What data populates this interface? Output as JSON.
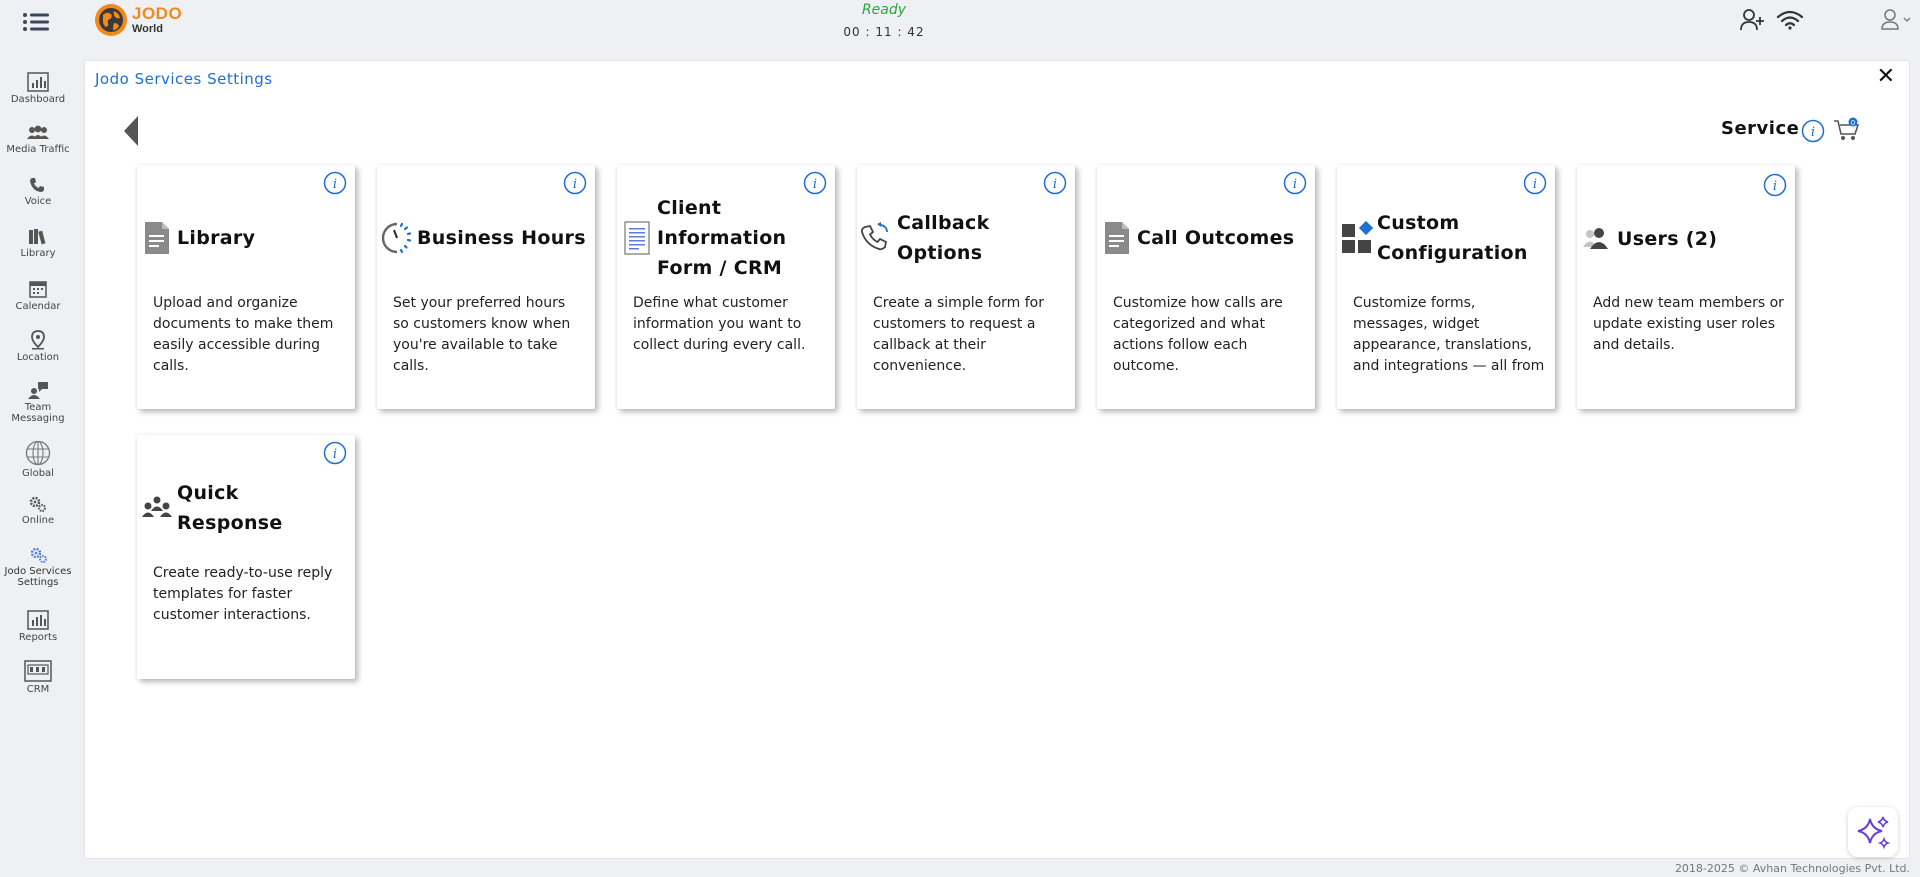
{
  "header": {
    "brand": "JODO",
    "brand_sub": "World",
    "status": "Ready",
    "timer": "00 : 11 : 42"
  },
  "colors": {
    "accent": "#1f6fd1",
    "ready": "#2aa93d",
    "brand": "#f08a1c"
  },
  "sidebar": {
    "items": [
      {
        "label": "Dashboard",
        "icon": "dashboard-icon"
      },
      {
        "label": "Media Traffic",
        "icon": "media-traffic-icon"
      },
      {
        "label": "Voice",
        "icon": "phone-icon"
      },
      {
        "label": "Library",
        "icon": "library-icon"
      },
      {
        "label": "Calendar",
        "icon": "calendar-icon"
      },
      {
        "label": "Location",
        "icon": "location-pin-icon"
      },
      {
        "label": "Team Messaging",
        "icon": "team-messaging-icon"
      },
      {
        "label": "Global",
        "icon": "globe-icon"
      },
      {
        "label": "Online",
        "icon": "gears-icon"
      },
      {
        "label": "Jodo Services Settings",
        "icon": "settings-gears-icon"
      },
      {
        "label": "Reports",
        "icon": "reports-icon"
      },
      {
        "label": "CRM",
        "icon": "crm-icon"
      }
    ]
  },
  "panel": {
    "title": "Jodo Services Settings",
    "service_label": "Service",
    "cart_count": "0"
  },
  "cards": [
    {
      "title": "Library",
      "icon": "document-icon",
      "description": "Upload and organize documents to make them easily accessible during calls."
    },
    {
      "title": "Business Hours",
      "icon": "clock-icon",
      "description": "Set your preferred hours so customers know when you're available to take calls."
    },
    {
      "title": "Client Information Form / CRM",
      "icon": "form-icon",
      "description": "Define what customer information you want to collect during every call."
    },
    {
      "title": "Callback Options",
      "icon": "callback-icon",
      "description": "Create a simple form for customers to request a callback at their convenience."
    },
    {
      "title": "Call Outcomes",
      "icon": "document-icon",
      "description": "Customize how calls are categorized and what actions follow each outcome."
    },
    {
      "title": "Custom Configuration",
      "icon": "widgets-icon",
      "description": "Customize forms, messages, widget appearance, translations, and integrations — all from"
    },
    {
      "title": "Users (2)",
      "icon": "users-icon",
      "description": "Add new team members or update existing user roles and details."
    },
    {
      "title": "Quick Response",
      "icon": "group-icon",
      "description": "Create ready-to-use reply templates for faster customer interactions."
    }
  ],
  "footer": {
    "copyright": "2018-2025 © Avhan Technologies Pvt. Ltd."
  }
}
